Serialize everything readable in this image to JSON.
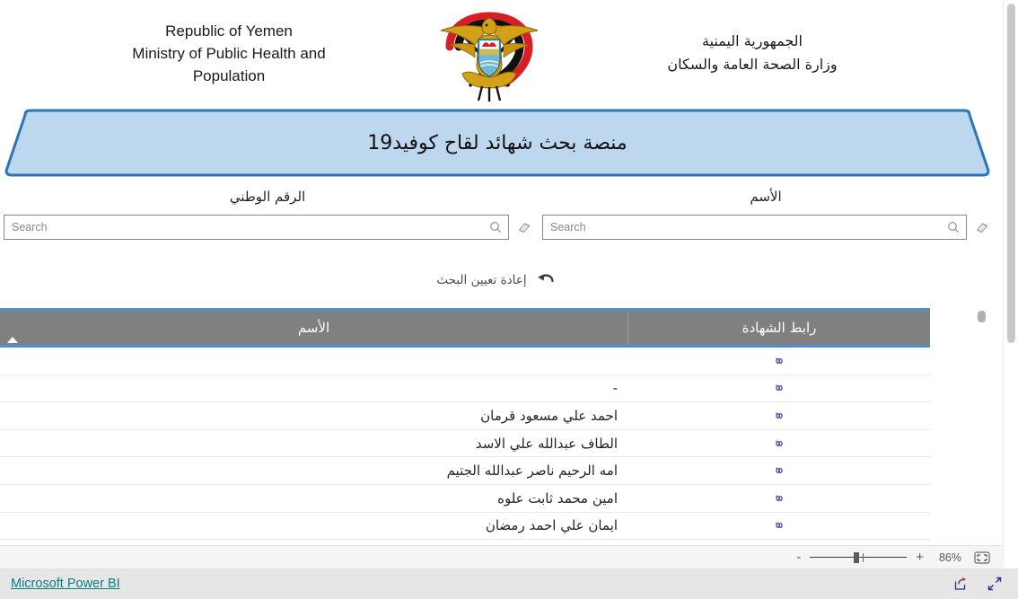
{
  "header": {
    "english_lines": [
      "Republic of Yemen",
      "Ministry of Public Health and",
      "Population"
    ],
    "arabic_lines": [
      "الجمهورية اليمنية",
      "وزارة الصحة العامة والسكان"
    ],
    "emblem_name": "yemen-national-emblem"
  },
  "banner": {
    "title": "منصة بحث شهائد لقاح كوفيد19",
    "fill_color": "#bdd7ee",
    "border_color": "#2e75b6"
  },
  "filters": {
    "national_id": {
      "label": "الرقم الوطني",
      "value": "",
      "placeholder": "Search",
      "search_icon": "search-icon",
      "clear_icon": "eraser-icon"
    },
    "name": {
      "label": "الأسم",
      "value": "",
      "placeholder": "Search",
      "search_icon": "search-icon",
      "clear_icon": "eraser-icon"
    },
    "reset": {
      "label": "إعادة تعيين البحث",
      "icon": "reset-arrow-icon"
    }
  },
  "table": {
    "columns": [
      {
        "key": "name",
        "label": "الأسم",
        "sorted": true,
        "sort_direction": "asc"
      },
      {
        "key": "link",
        "label": "رابط الشهادة",
        "sorted": false
      }
    ],
    "header_background": "#808080",
    "header_border": "#4a90d9",
    "link_icon": "chain-link-icon",
    "rows": [
      {
        "name": "",
        "link_icon": "chain-link-icon"
      },
      {
        "name": "-",
        "link_icon": "chain-link-icon"
      },
      {
        "name": "احمد علي مسعود قرمان",
        "link_icon": "chain-link-icon"
      },
      {
        "name": "الطاف عبدالله علي الاسد",
        "link_icon": "chain-link-icon"
      },
      {
        "name": "امه الرحيم ناصر عبدالله الجتيم",
        "link_icon": "chain-link-icon"
      },
      {
        "name": "امين محمد ثابت علوه",
        "link_icon": "chain-link-icon"
      },
      {
        "name": "ايمان علي احمد رمضان",
        "link_icon": "chain-link-icon"
      },
      {
        "name": "",
        "link_icon": "chain-link-icon"
      }
    ]
  },
  "zoombar": {
    "minus_label": "-",
    "plus_label": "+",
    "percent": "86%",
    "fit_icon": "fit-to-page-icon"
  },
  "footer": {
    "brand": "Microsoft Power BI",
    "brand_color": "#107c84",
    "share_icon": "share-icon",
    "fullscreen_icon": "fullscreen-icon"
  }
}
